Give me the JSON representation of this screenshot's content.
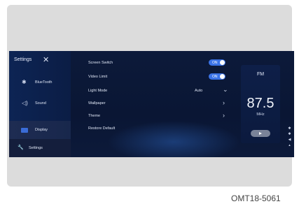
{
  "sidebar": {
    "title": "Settings",
    "close_glyph": "✕",
    "items": [
      {
        "icon": "bluetooth-icon",
        "glyph": "✱",
        "label": "BlueTooth"
      },
      {
        "icon": "sound-icon",
        "glyph": "◁)",
        "label": "Sound"
      },
      {
        "icon": "display-icon",
        "label": "Display"
      },
      {
        "icon": "wrench-icon",
        "glyph": "🔧",
        "label": "Settings"
      }
    ]
  },
  "settings": {
    "screen_switch": {
      "label": "Screen Switch",
      "toggle": "ON"
    },
    "video_limit": {
      "label": "Video Limit",
      "toggle": "ON"
    },
    "light_mode": {
      "label": "Light Mode",
      "value": "Auto",
      "chevron": "⌄"
    },
    "wallpaper": {
      "label": "Wallpaper",
      "chevron": "›"
    },
    "theme": {
      "label": "Theme",
      "chevron": "›"
    },
    "restore_default": {
      "label": "Restore Default"
    }
  },
  "radio": {
    "band": "FM",
    "frequency": "87.5",
    "unit": "MHz"
  },
  "status_icons": [
    "bluetooth-icon",
    "bluetooth-icon",
    "volume-icon",
    "signal-icon"
  ],
  "caption": "OMT18-5061",
  "colors": {
    "screen_bg": "#0a1634",
    "accent": "#3b73e6",
    "sidebar_bg": "#0d2454"
  }
}
